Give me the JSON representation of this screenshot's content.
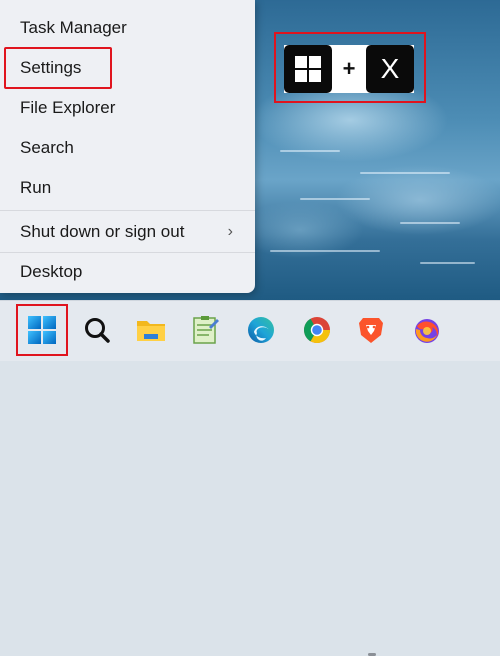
{
  "start_menu": {
    "items": [
      {
        "label": "Task Manager"
      },
      {
        "label": "Settings"
      },
      {
        "label": "File Explorer"
      },
      {
        "label": "Search"
      },
      {
        "label": "Run"
      },
      {
        "label": "Shut down or sign out",
        "submenu": true
      },
      {
        "label": "Desktop"
      }
    ],
    "highlighted_item": "Settings"
  },
  "shortcut_callout": {
    "key1_icon": "windows-logo-icon",
    "plus": "+",
    "key2": "X"
  },
  "taskbar": {
    "icons": [
      {
        "name": "start-button",
        "icon": "windows-logo-icon",
        "highlighted": true
      },
      {
        "name": "search",
        "icon": "search-icon"
      },
      {
        "name": "file-explorer",
        "icon": "folder-icon"
      },
      {
        "name": "notepad",
        "icon": "notepad-icon"
      },
      {
        "name": "edge",
        "icon": "edge-icon"
      },
      {
        "name": "chrome",
        "icon": "chrome-icon"
      },
      {
        "name": "brave",
        "icon": "brave-icon",
        "running": true
      },
      {
        "name": "firefox",
        "icon": "firefox-icon"
      }
    ]
  },
  "colors": {
    "highlight": "#e0141e",
    "menu_bg": "#eef0f4",
    "taskbar_bg": "#e4e9ef"
  }
}
